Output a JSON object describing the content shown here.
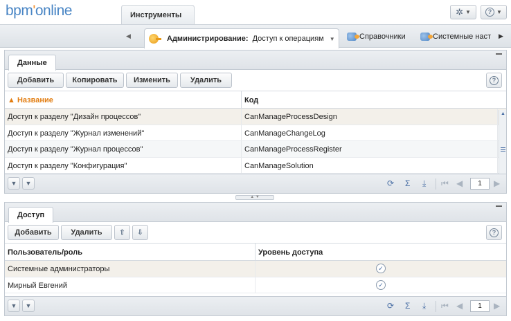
{
  "logo": {
    "prefix": "bpm",
    "dot": "'",
    "suffix": "online"
  },
  "header": {
    "tools_tab": "Инструменты",
    "gear_icon": "gear-icon",
    "help_icon": "help-icon"
  },
  "nav": {
    "active_label": "Администрирование:",
    "active_sub": "Доступ к операциям",
    "items": [
      "Справочники",
      "Системные наст"
    ]
  },
  "data_panel": {
    "tab": "Данные",
    "buttons": {
      "add": "Добавить",
      "copy": "Копировать",
      "edit": "Изменить",
      "delete": "Удалить"
    },
    "columns": [
      "Название",
      "Код"
    ],
    "rows": [
      {
        "name": "Доступ к разделу \"Дизайн процессов\"",
        "code": "CanManageProcessDesign"
      },
      {
        "name": "Доступ к разделу \"Журнал изменений\"",
        "code": "CanManageChangeLog"
      },
      {
        "name": "Доступ к разделу \"Журнал процессов\"",
        "code": "CanManageProcessRegister"
      },
      {
        "name": "Доступ к разделу \"Конфигурация\"",
        "code": "CanManageSolution"
      }
    ],
    "page": "1"
  },
  "access_panel": {
    "tab": "Доступ",
    "buttons": {
      "add": "Добавить",
      "delete": "Удалить"
    },
    "columns": [
      "Пользователь/роль",
      "Уровень доступа"
    ],
    "rows": [
      {
        "name": "Системные администраторы",
        "checked": true
      },
      {
        "name": "Мирный Евгений",
        "checked": true
      }
    ],
    "page": "1"
  },
  "colors": {
    "accent": "#4a86c5",
    "sort": "#e27c0f",
    "selected_row": "#f3f0ea"
  }
}
